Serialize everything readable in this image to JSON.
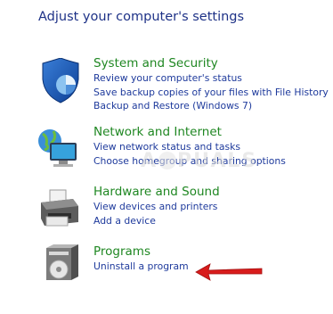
{
  "page": {
    "title": "Adjust your computer's settings"
  },
  "categories": [
    {
      "title": "System and Security",
      "icon": "shield-icon",
      "links": [
        "Review your computer's status",
        "Save backup copies of your files with File History",
        "Backup and Restore (Windows 7)"
      ]
    },
    {
      "title": "Network and Internet",
      "icon": "network-globe-icon",
      "links": [
        "View network status and tasks",
        "Choose homegroup and sharing options"
      ]
    },
    {
      "title": "Hardware and Sound",
      "icon": "printer-icon",
      "links": [
        "View devices and printers",
        "Add a device"
      ]
    },
    {
      "title": "Programs",
      "icon": "programs-disc-icon",
      "links": [
        "Uninstall a program"
      ]
    }
  ],
  "watermark": {
    "left": "A",
    "right": "PUALS"
  },
  "colors": {
    "title": "#1e3287",
    "category": "#1f8722",
    "link": "#1e3a9c",
    "arrow": "#d81c1c"
  }
}
